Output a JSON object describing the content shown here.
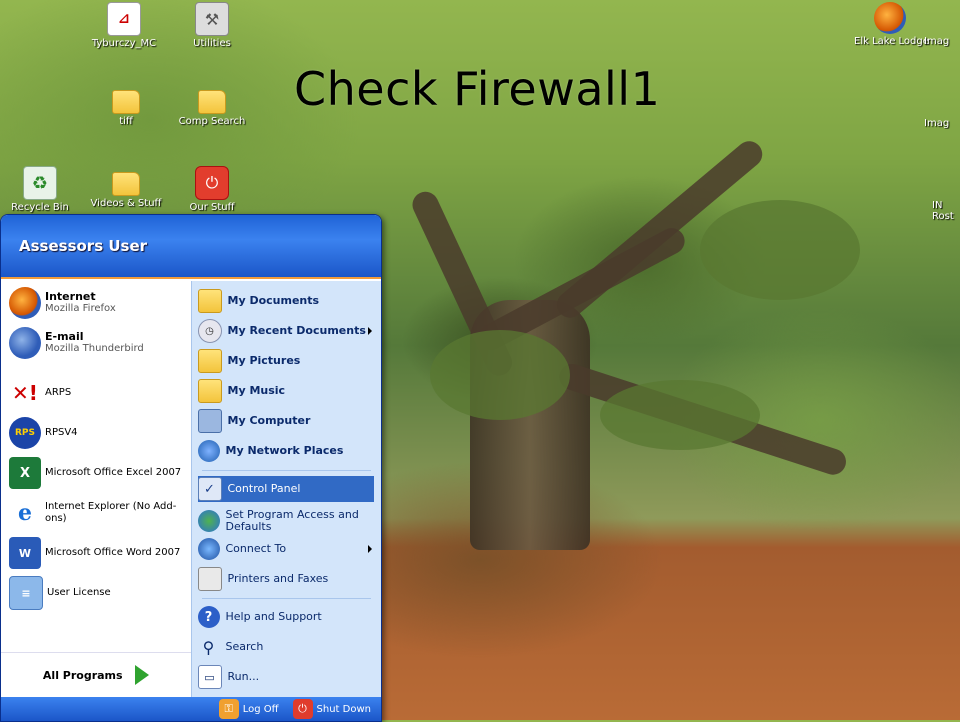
{
  "overlay_title": "Check Firewall1",
  "desktop_icons": [
    {
      "label": "Tyburczy_MC",
      "icon": "pdf-icon"
    },
    {
      "label": "Utilities",
      "icon": "tools-icon"
    },
    {
      "label": "tiff",
      "icon": "folder-icon"
    },
    {
      "label": "Comp Search",
      "icon": "folder-icon"
    },
    {
      "label": "Recycle Bin",
      "icon": "recycle-bin-icon"
    },
    {
      "label": "Videos & Stuff",
      "icon": "folder-icon"
    },
    {
      "label": "Our Stuff",
      "icon": "power-icon"
    },
    {
      "label": "Elk Lake Lodge",
      "icon": "firefox-shortcut-icon"
    },
    {
      "label": "Imag",
      "icon": "image-icon"
    },
    {
      "label": "Imag",
      "icon": "image-icon"
    },
    {
      "label": "IN",
      "icon": "document-icon"
    },
    {
      "label": "Rost",
      "icon": "document-icon"
    }
  ],
  "start_menu": {
    "user_name": "Assessors User",
    "left_items": [
      {
        "title": "Internet",
        "subtitle": "Mozilla Firefox"
      },
      {
        "title": "E-mail",
        "subtitle": "Mozilla Thunderbird"
      },
      {
        "title": "ARPS"
      },
      {
        "title": "RPSV4"
      },
      {
        "title": "Microsoft Office Excel 2007"
      },
      {
        "title": "Internet Explorer (No Add-ons)"
      },
      {
        "title": "Microsoft Office Word 2007"
      },
      {
        "title": "User License"
      }
    ],
    "all_programs": "All Programs",
    "right_items": [
      {
        "label": "My Documents"
      },
      {
        "label": "My Recent Documents"
      },
      {
        "label": "My Pictures"
      },
      {
        "label": "My Music"
      },
      {
        "label": "My Computer"
      },
      {
        "label": "My Network Places"
      },
      {
        "label": "Control Panel"
      },
      {
        "label": "Set Program Access and Defaults"
      },
      {
        "label": "Connect To"
      },
      {
        "label": "Printers and Faxes"
      },
      {
        "label": "Help and Support"
      },
      {
        "label": "Search"
      },
      {
        "label": "Run..."
      }
    ],
    "log_off": "Log Off",
    "shut_down": "Shut Down"
  },
  "colors": {
    "start_header": "#1f63d6",
    "right_pane": "#d3e5fa",
    "selection": "#316ac5",
    "accent_orange": "#f39c3a"
  }
}
